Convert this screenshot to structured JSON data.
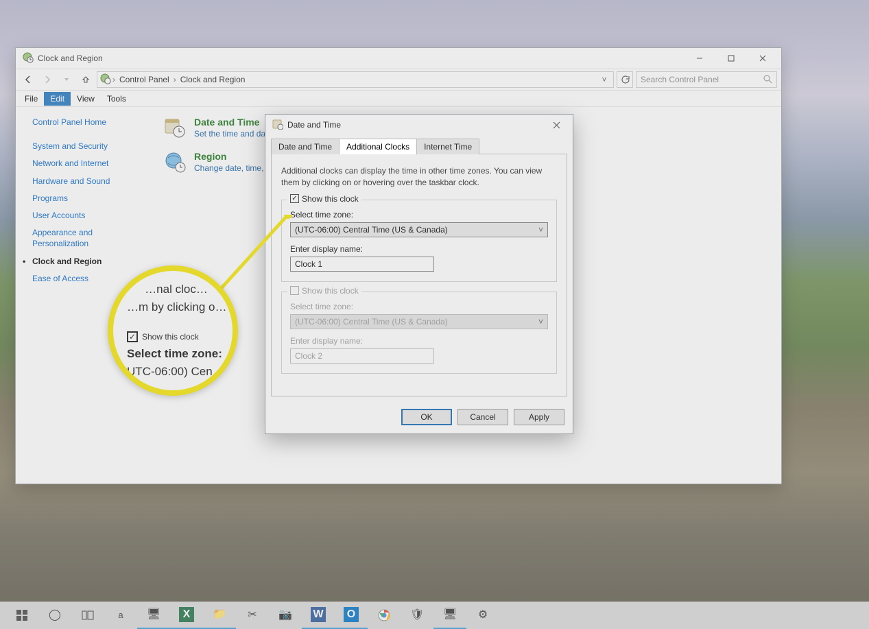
{
  "window": {
    "title": "Clock and Region",
    "breadcrumb": [
      "Control Panel",
      "Clock and Region"
    ],
    "search_placeholder": "Search Control Panel",
    "menus": [
      "File",
      "Edit",
      "View",
      "Tools"
    ],
    "active_menu_index": 1
  },
  "sidebar": {
    "home": "Control Panel Home",
    "items": [
      "System and Security",
      "Network and Internet",
      "Hardware and Sound",
      "Programs",
      "User Accounts",
      "Appearance and Personalization",
      "Clock and Region",
      "Ease of Access"
    ],
    "active_index": 6
  },
  "categories": {
    "datetime": {
      "title": "Date and Time",
      "sub": "Set the time and date"
    },
    "region": {
      "title": "Region",
      "sub": "Change date, time, or number formats"
    }
  },
  "dialog": {
    "title": "Date and Time",
    "tabs": [
      "Date and Time",
      "Additional Clocks",
      "Internet Time"
    ],
    "active_tab_index": 1,
    "description": "Additional clocks can display the time in other time zones. You can view them by clicking on or hovering over the taskbar clock.",
    "clock1": {
      "show_label": "Show this clock",
      "checked": true,
      "tz_label": "Select time zone:",
      "tz_value": "(UTC-06:00) Central Time (US & Canada)",
      "name_label": "Enter display name:",
      "name_value": "Clock 1"
    },
    "clock2": {
      "show_label": "Show this clock",
      "checked": false,
      "tz_label": "Select time zone:",
      "tz_value": "(UTC-06:00) Central Time (US & Canada)",
      "name_label": "Enter display name:",
      "name_value": "Clock 2"
    },
    "buttons": {
      "ok": "OK",
      "cancel": "Cancel",
      "apply": "Apply"
    }
  },
  "callout": {
    "line1": "…nal cloc…",
    "line2": "…m by clicking o…",
    "show": "Show this clock",
    "tz": "Select time zone:",
    "tzval": "UTC-06:00) Cen"
  },
  "taskbar_icons": [
    "start-icon",
    "cortana-icon",
    "taskview-icon",
    "amazon-icon",
    "desktop-icon",
    "excel-icon",
    "explorer-icon",
    "snip-icon",
    "paintnet-icon",
    "word-icon",
    "outlook-icon",
    "chrome-icon",
    "security-icon",
    "controlpanel-icon",
    "settings-icon"
  ]
}
